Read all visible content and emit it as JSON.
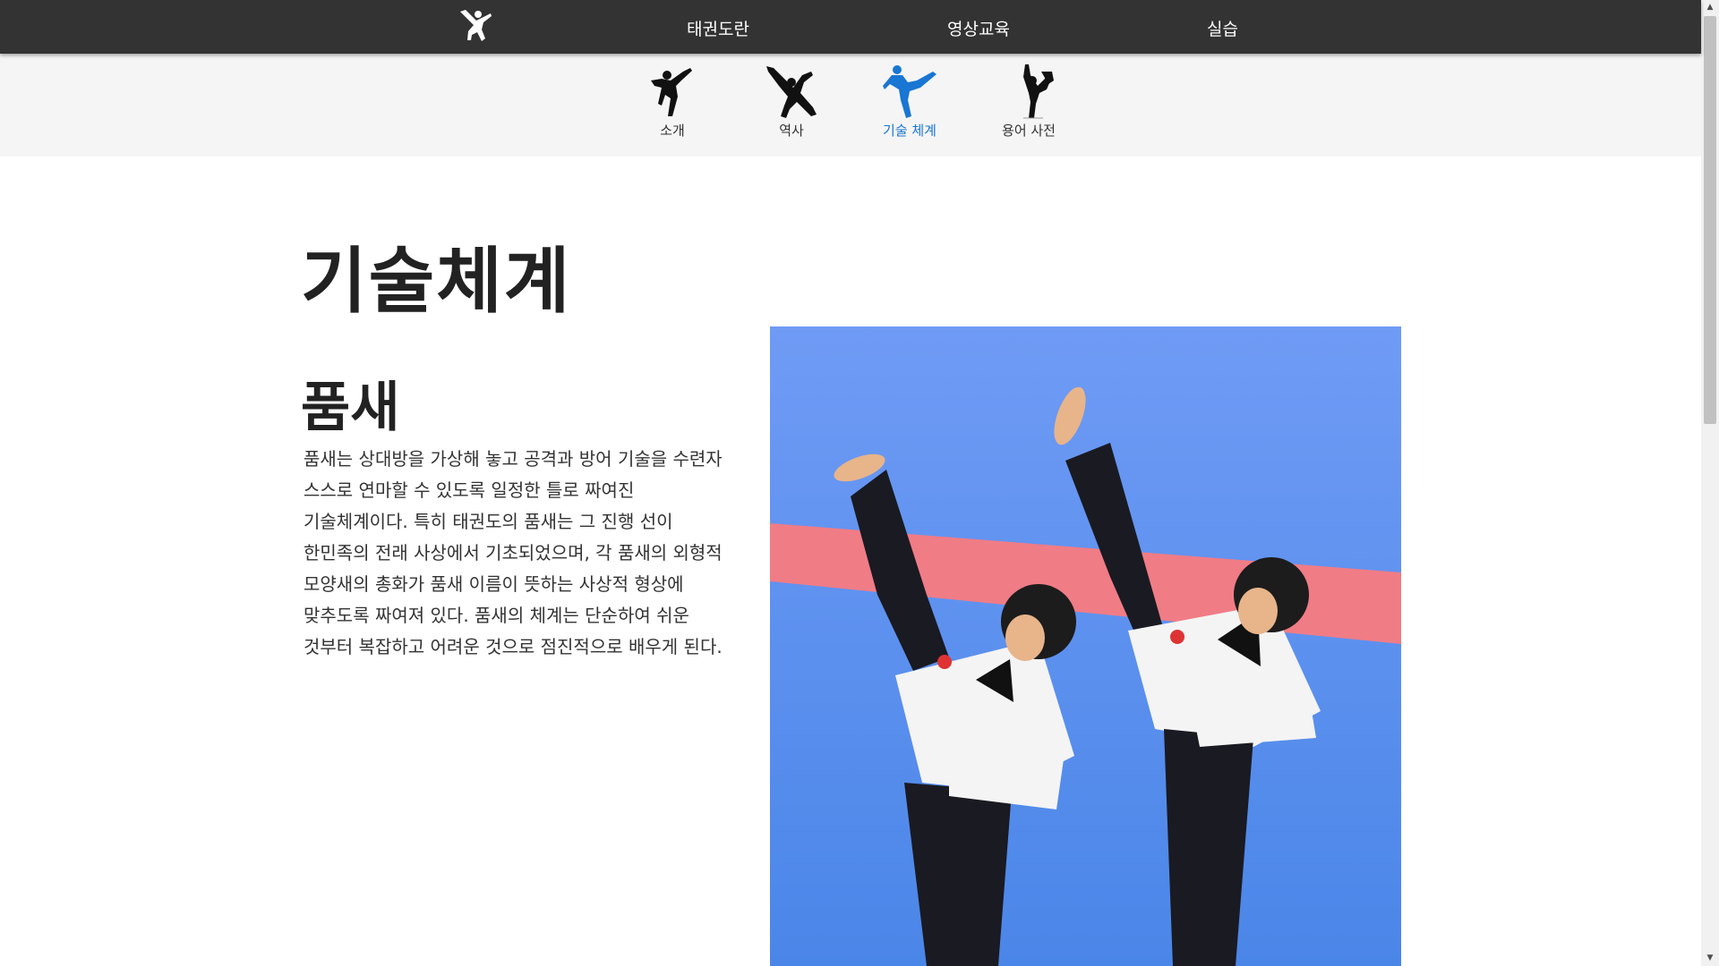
{
  "topbar": {
    "logo_icon": "taekwondo-kick-logo",
    "nav": [
      {
        "label": "태권도란"
      },
      {
        "label": "영상교육"
      },
      {
        "label": "실습"
      }
    ]
  },
  "subnav": {
    "items": [
      {
        "label": "소개",
        "icon": "kick-silhouette-icon",
        "active": false
      },
      {
        "label": "역사",
        "icon": "jump-kick-silhouette-icon",
        "active": false
      },
      {
        "label": "기술 체계",
        "icon": "side-kick-silhouette-icon",
        "active": true
      },
      {
        "label": "용어 사전",
        "icon": "high-kick-silhouette-icon",
        "active": false
      }
    ],
    "active_color": "#1976d2"
  },
  "main": {
    "title": "기술체계",
    "section": {
      "title": "품새",
      "body": "품새는 상대방을 가상해 놓고 공격과 방어 기술을 수련자 스스로 연마할 수 있도록 일정한 틀로 짜여진 기술체계이다. 특히 태권도의 품새는 그 진행 선이 한민족의 전래 사상에서 기초되었으며, 각 품새의 외형적 모양새의 총화가 품새 이름이 뜻하는 사상적 형상에 맞추도록 짜여져 있다. 품새의 체계는 단순하여 쉬운 것부터 복잡하고 어려운 것으로 점진적으로 배우게 된다."
    },
    "photo": {
      "subject": "two taekwondo athletes performing high kicks on a blue mat"
    }
  },
  "colors": {
    "topbar": "#333333",
    "subnav_bg": "#f5f5f5",
    "mat_blue": "#5b8ef0"
  }
}
